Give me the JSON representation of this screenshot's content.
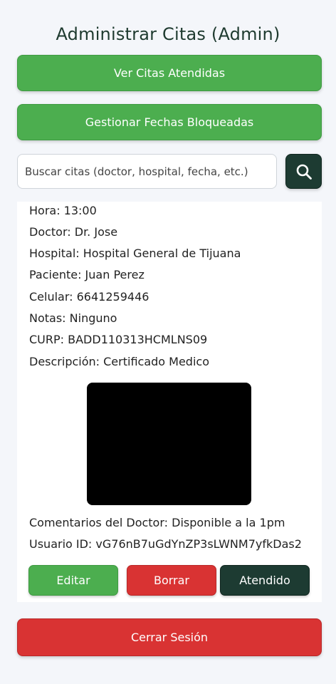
{
  "header": {
    "title": "Administrar Citas (Admin)"
  },
  "actions": {
    "ver_citas_label": "Ver Citas Atendidas",
    "gestionar_label": "Gestionar Fechas Bloqueadas"
  },
  "search": {
    "placeholder": "Buscar citas (doctor, hospital, fecha, etc.)",
    "value": "",
    "icon": "search-icon"
  },
  "appointment": {
    "hora": "Hora: 13:00",
    "doctor": "Doctor: Dr. Jose",
    "hospital": "Hospital: Hospital General de Tijuana",
    "paciente": "Paciente: Juan Perez",
    "celular": "Celular: 6641259446",
    "notas": "Notas: Ninguno",
    "curp": "CURP: BADD110313HCMLNS09",
    "descripcion": "Descripción: Certificado Medico",
    "comentarios": "Comentarios del Doctor: Disponible a la 1pm",
    "usuario_id": "Usuario ID: vG76nB7uGdYnZP3sLWNM7yfkDas2",
    "buttons": {
      "editar": "Editar",
      "borrar": "Borrar",
      "atendido": "Atendido"
    }
  },
  "footer": {
    "cerrar_label": "Cerrar Sesión"
  },
  "colors": {
    "green": "#4cae4f",
    "red": "#d93333",
    "dark_green": "#1d3b32",
    "background": "#f4f6fa"
  }
}
